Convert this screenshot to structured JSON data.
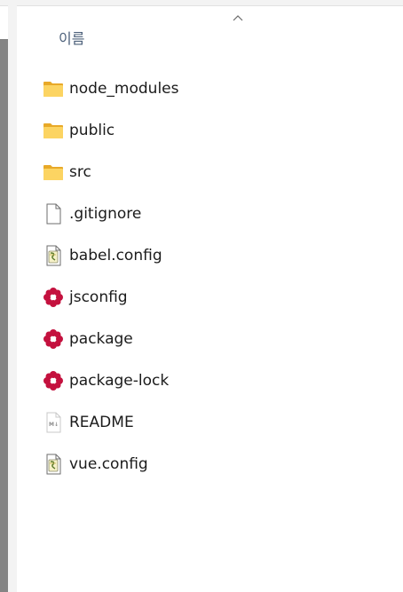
{
  "column_header": {
    "name_label": "이름",
    "sort_direction": "ascending"
  },
  "files": [
    {
      "name": "node_modules",
      "icon": "folder-icon"
    },
    {
      "name": "public",
      "icon": "folder-icon"
    },
    {
      "name": "src",
      "icon": "folder-icon"
    },
    {
      "name": ".gitignore",
      "icon": "file-icon"
    },
    {
      "name": "babel.config",
      "icon": "js-script-icon"
    },
    {
      "name": "jsconfig",
      "icon": "json-icon"
    },
    {
      "name": "package",
      "icon": "json-icon"
    },
    {
      "name": "package-lock",
      "icon": "json-icon"
    },
    {
      "name": "README",
      "icon": "markdown-icon"
    },
    {
      "name": "vue.config",
      "icon": "js-script-icon"
    }
  ],
  "colors": {
    "folder": "#f5c342",
    "json_flower": "#c4113e",
    "header_text": "#4c607a"
  }
}
